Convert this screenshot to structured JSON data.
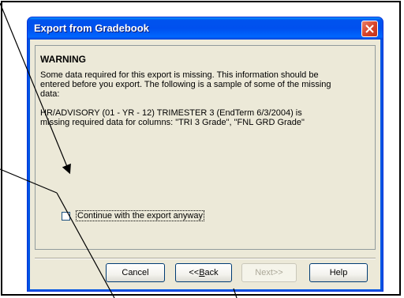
{
  "window": {
    "title": "Export from Gradebook"
  },
  "warning": {
    "heading": "WARNING",
    "line1": "Some data required for this export is missing. This information should be",
    "line2": "entered before you export.  The following is a sample of some of the missing",
    "line3": "data:",
    "detail_line1": "HR/ADVISORY (01 - YR - 12) TRIMESTER 3 (EndTerm 6/3/2004) is",
    "detail_line2": "missing required data for columns: \"TRI 3 Grade\", \"FNL GRD Grade\""
  },
  "checkbox": {
    "label": "Continue with the export anyway",
    "checked": false
  },
  "buttons": {
    "cancel": "Cancel",
    "back": "<<Back",
    "next": "Next>>",
    "help": "Help"
  },
  "icons": {
    "close": "close-icon"
  },
  "colors": {
    "titlebar": "#0054e3",
    "client": "#ece9d8",
    "close_button": "#d9452a"
  }
}
